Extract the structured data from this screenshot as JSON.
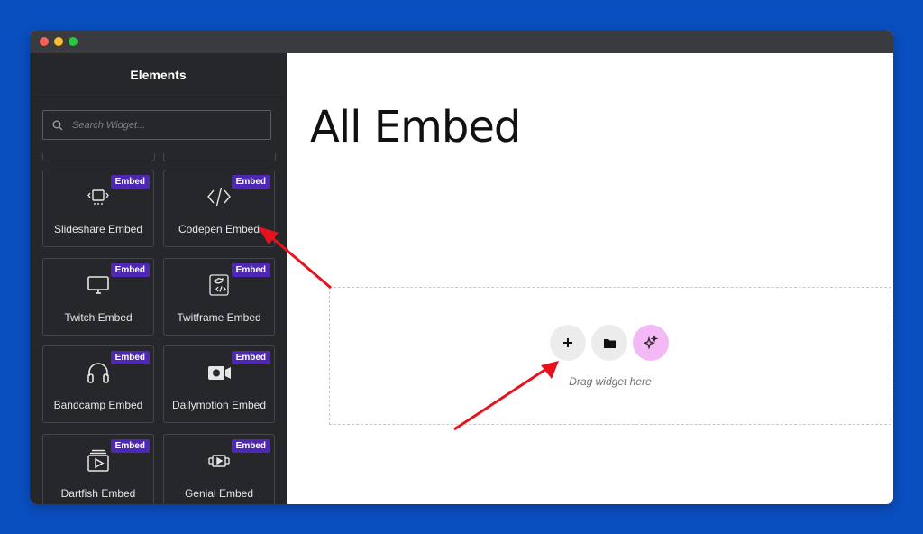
{
  "panel": {
    "title": "Elements",
    "search_placeholder": "Search Widget..."
  },
  "widgets": [
    {
      "label": "Slideshare Embed",
      "badge": "Embed",
      "icon": "slideshare-icon"
    },
    {
      "label": "Codepen Embed",
      "badge": "Embed",
      "icon": "code-icon"
    },
    {
      "label": "Twitch Embed",
      "badge": "Embed",
      "icon": "monitor-icon"
    },
    {
      "label": "Twitframe Embed",
      "badge": "Embed",
      "icon": "twitter-code-icon"
    },
    {
      "label": "Bandcamp Embed",
      "badge": "Embed",
      "icon": "headphones-icon"
    },
    {
      "label": "Dailymotion Embed",
      "badge": "Embed",
      "icon": "video-camera-icon"
    },
    {
      "label": "Dartfish Embed",
      "badge": "Embed",
      "icon": "play-window-icon"
    },
    {
      "label": "Genial Embed",
      "badge": "Embed",
      "icon": "film-icon"
    }
  ],
  "canvas": {
    "page_title": "All Embed",
    "dropzone_text": "Drag widget here",
    "buttons": [
      "add-icon",
      "folder-icon",
      "sparkle-icon"
    ]
  },
  "colors": {
    "background": "#0a4fc0",
    "panel": "#26272b",
    "badge": "#4f27b5",
    "ai_button": "#f3b8f6",
    "arrow": "#e8121e"
  }
}
